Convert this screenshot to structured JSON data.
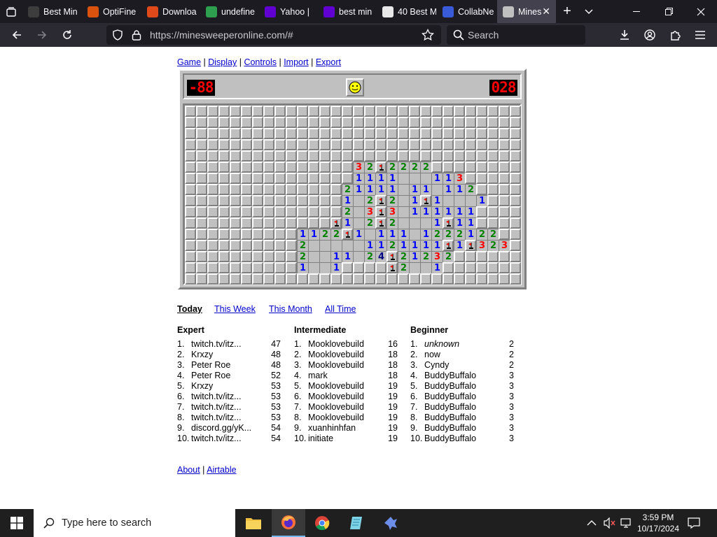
{
  "browser": {
    "tabs": [
      {
        "title": "Best Min",
        "favicon": "tab-favicon-best",
        "color": "#3d3d3d"
      },
      {
        "title": "OptiFine",
        "favicon": "tab-favicon-optifine",
        "color": "#d9530f"
      },
      {
        "title": "Downloa",
        "favicon": "tab-favicon-download",
        "color": "#e04a1a"
      },
      {
        "title": "undefine",
        "favicon": "tab-favicon-bl",
        "color": "#2e9e4f"
      },
      {
        "title": "Yahoo |",
        "favicon": "tab-favicon-yahoo",
        "color": "#6001d2"
      },
      {
        "title": "best min",
        "favicon": "tab-favicon-yahoo",
        "color": "#6001d2"
      },
      {
        "title": "40 Best M",
        "favicon": "tab-favicon-40best",
        "color": "#e8e8e8"
      },
      {
        "title": "CollabNe",
        "favicon": "tab-favicon-search",
        "color": "#3a5bd9"
      },
      {
        "title": "Mines",
        "favicon": "tab-favicon-minesweeper",
        "color": "#c0c0c0"
      }
    ],
    "url": "https://minesweeperonline.com/#",
    "search_placeholder": "Search",
    "accent": "#76b9ed"
  },
  "page": {
    "menu": [
      "Game",
      "Display",
      "Controls",
      "Import",
      "Export"
    ],
    "mines_counter": "-88",
    "timer": "028",
    "face": "smiley-face",
    "board": {
      "cols": 30,
      "rows": 16,
      "legend": "H=hidden, .=revealed empty, 1-8=number, F=flag",
      "grid": [
        "HHHHHHHHHHHHHHHHHHHHHHHHHHHHHH",
        "HHHHHHHHHHHHHHHHHHHHHHHHHHHHHH",
        "HHHHHHHHHHHHHHHHHHHHHHHHHHHHHH",
        "HHHHHHHHHHHHHHHHHHHHHHHHHHHHHH",
        "HHHHHHHHHHHHHHHHHHHHHHHHHHHHHH",
        "HHHHHHHHHHHHHHH32F2222HHHHHHHH",
        "HHHHHHHHHHHHHHH1111...113HHHHH",
        "HHHHHHHHHHHHHH21111.11.112HHHH",
        "HHHHHHHHHHHHHH1.2F2.1F1...1HHH",
        "HHHHHHHHHHHHHH2.3F3.111111HHHH",
        "HHHHHHHHHHHHHF1.2F2...1F11HHHH",
        "HHHHHHHHHH1122F1.111.1222122HH",
        "HHHHHHHHHH2.....1121111F1F323H",
        "HHHHHHHHHH2..11.24F21232HHHHHH",
        "HHHHHHHHHH1..1HHHHF2..1HHHHHHH",
        "HHHHHHHHHHHHHHHHHHHHHHHHHHHHHH"
      ],
      "number_colors": {
        "1": "#0000ff",
        "2": "#008000",
        "3": "#ff0000",
        "4": "#000080"
      }
    },
    "periods": [
      {
        "label": "Today",
        "current": true
      },
      {
        "label": "This Week",
        "current": false
      },
      {
        "label": "This Month",
        "current": false
      },
      {
        "label": "All Time",
        "current": false
      }
    ],
    "leaderboards": [
      {
        "title": "Expert",
        "entries": [
          {
            "rank": "1.",
            "name": "twitch.tv/itz...",
            "score": "47"
          },
          {
            "rank": "2.",
            "name": "Krxzy",
            "score": "48"
          },
          {
            "rank": "3.",
            "name": "Peter Roe",
            "score": "48"
          },
          {
            "rank": "4.",
            "name": "Peter Roe",
            "score": "52"
          },
          {
            "rank": "5.",
            "name": "Krxzy",
            "score": "53"
          },
          {
            "rank": "6.",
            "name": "twitch.tv/itz...",
            "score": "53"
          },
          {
            "rank": "7.",
            "name": "twitch.tv/itz...",
            "score": "53"
          },
          {
            "rank": "8.",
            "name": "twitch.tv/itz...",
            "score": "53"
          },
          {
            "rank": "9.",
            "name": "discord.gg/yK...",
            "score": "54"
          },
          {
            "rank": "10.",
            "name": "twitch.tv/itz...",
            "score": "54"
          }
        ]
      },
      {
        "title": "Intermediate",
        "entries": [
          {
            "rank": "1.",
            "name": "Mooklovebuild",
            "score": "16"
          },
          {
            "rank": "2.",
            "name": "Mooklovebuild",
            "score": "18"
          },
          {
            "rank": "3.",
            "name": "Mooklovebuild",
            "score": "18"
          },
          {
            "rank": "4.",
            "name": "mark",
            "score": "18"
          },
          {
            "rank": "5.",
            "name": "Mooklovebuild",
            "score": "19"
          },
          {
            "rank": "6.",
            "name": "Mooklovebuild",
            "score": "19"
          },
          {
            "rank": "7.",
            "name": "Mooklovebuild",
            "score": "19"
          },
          {
            "rank": "8.",
            "name": "Mooklovebuild",
            "score": "19"
          },
          {
            "rank": "9.",
            "name": "xuanhinhfan",
            "score": "19"
          },
          {
            "rank": "10.",
            "name": "initiate",
            "score": "19"
          }
        ]
      },
      {
        "title": "Beginner",
        "entries": [
          {
            "rank": "1.",
            "name": "unknown",
            "score": "2",
            "italic": true
          },
          {
            "rank": "2.",
            "name": "now",
            "score": "2"
          },
          {
            "rank": "3.",
            "name": "Cyndy",
            "score": "2"
          },
          {
            "rank": "4.",
            "name": "BuddyBuffalo",
            "score": "3"
          },
          {
            "rank": "5.",
            "name": "BuddyBuffalo",
            "score": "3"
          },
          {
            "rank": "6.",
            "name": "BuddyBuffalo",
            "score": "3"
          },
          {
            "rank": "7.",
            "name": "BuddyBuffalo",
            "score": "3"
          },
          {
            "rank": "8.",
            "name": "BuddyBuffalo",
            "score": "3"
          },
          {
            "rank": "9.",
            "name": "BuddyBuffalo",
            "score": "3"
          },
          {
            "rank": "10.",
            "name": "BuddyBuffalo",
            "score": "3"
          }
        ]
      }
    ],
    "footer": [
      "About",
      "Airtable"
    ]
  },
  "taskbar": {
    "search_placeholder": "Type here to search",
    "apps": [
      "file-explorer-icon",
      "firefox-icon",
      "chrome-icon",
      "notepad-icon",
      "game-app-icon"
    ],
    "time": "3:59 PM",
    "date": "10/17/2024"
  }
}
